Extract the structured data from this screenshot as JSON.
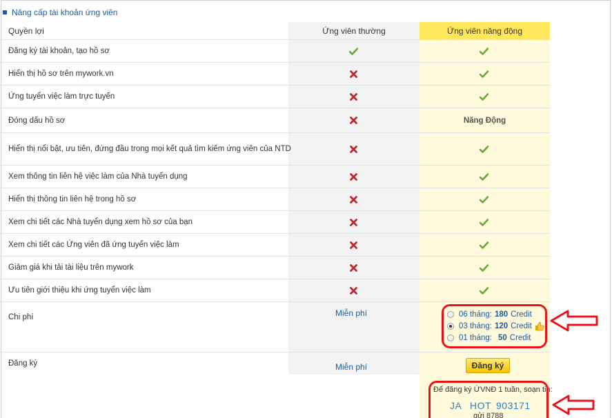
{
  "title": "Nâng cấp tài khoản ứng viên",
  "headers": {
    "benefit": "Quyền lợi",
    "regular": "Ứng viên thường",
    "active": "Ứng viên năng động"
  },
  "rows": [
    {
      "label": "Đăng ký tài khoản, tạo hồ sơ",
      "regular": "check",
      "active": "check"
    },
    {
      "label": "Hiển thị hồ sơ trên mywork.vn",
      "regular": "cross",
      "active": "check"
    },
    {
      "label": "Ứng tuyển việc làm trực tuyến",
      "regular": "cross",
      "active": "check"
    },
    {
      "label": "Đóng dấu hồ sơ",
      "regular": "cross",
      "active_text": "Năng Động"
    },
    {
      "label": "Hiển thị nổi bật, ưu tiên, đứng đầu trong mọi kết quả tìm kiếm ứng viên của NTD",
      "regular": "cross",
      "active": "check"
    },
    {
      "label": "Xem thông tin liên hệ việc làm của Nhà tuyển dụng",
      "regular": "cross",
      "active": "check"
    },
    {
      "label": "Hiển thị thông tin liên hệ trong hồ sơ",
      "regular": "cross",
      "active": "check"
    },
    {
      "label": "Xem chi tiết các Nhà tuyển dụng xem hồ sơ của bạn",
      "regular": "cross",
      "active": "check"
    },
    {
      "label": "Xem chi tiết các Ứng viên đã ứng tuyển việc làm",
      "regular": "cross",
      "active": "check"
    },
    {
      "label": "Giảm giá khi tải tài liệu trên mywork",
      "regular": "cross",
      "active": "check"
    },
    {
      "label": "Ưu tiên giới thiệu khi ứng tuyển việc làm",
      "regular": "cross",
      "active": "check"
    }
  ],
  "cost": {
    "label": "Chi phí",
    "regular": "Miễn phí",
    "options": [
      {
        "months": "06 tháng:",
        "credit": "180",
        "unit": "Credit",
        "selected": false
      },
      {
        "months": "03 tháng:",
        "credit": "120",
        "unit": "Credit",
        "selected": true
      },
      {
        "months": "01 tháng:",
        "credit": "50",
        "unit": "Credit",
        "selected": false
      }
    ]
  },
  "register": {
    "label": "Đăng ký",
    "regular": "Miễn phí",
    "button": "Đăng ký",
    "sms_text": "Để đăng ký ỨVNĐ 1 tuần, soạn tin:",
    "sms_code": [
      "JA",
      "HOT",
      "903171"
    ],
    "sms_send": "gửi 8788"
  },
  "colors": {
    "accent": "#1f5a9c",
    "highlight": "#ffe65a",
    "highlight_bg": "#fffadb",
    "annotation": "#e8131a",
    "check": "#6aa73a",
    "cross": "#c0272d"
  }
}
